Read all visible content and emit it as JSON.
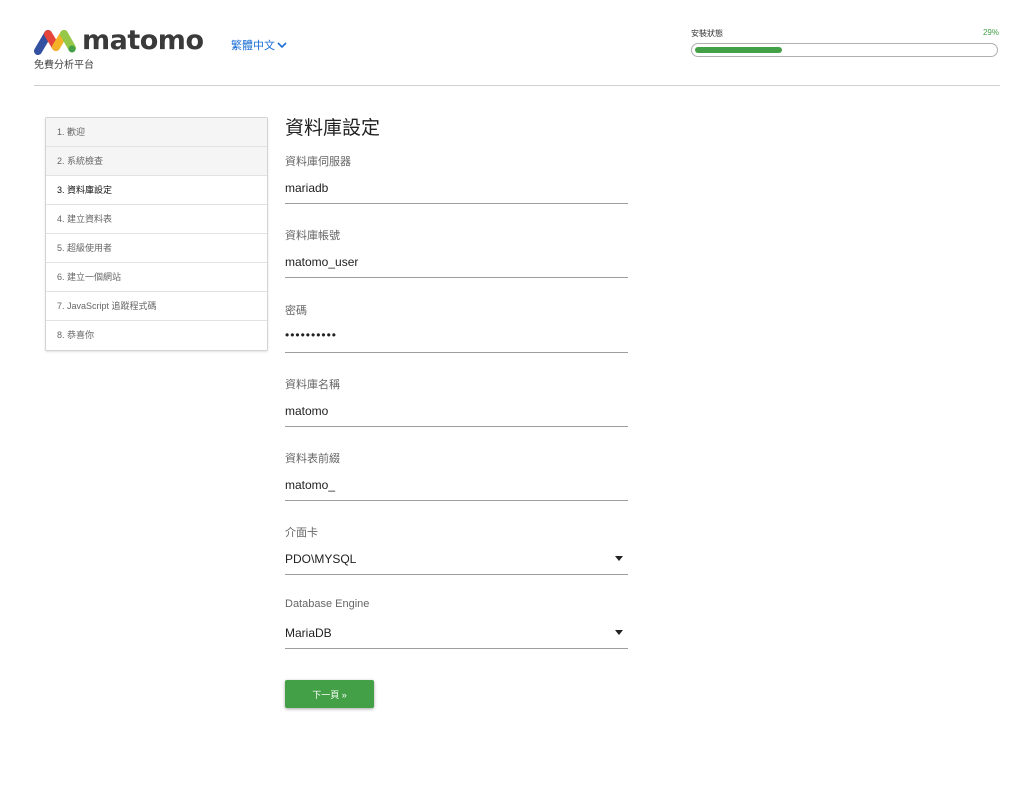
{
  "app": {
    "name": "matomo",
    "tagline": "免費分析平台",
    "language": "繁體中文"
  },
  "progress": {
    "label": "安裝狀態",
    "percent_text": "29%",
    "percent": 29,
    "color": "#43a047"
  },
  "steps": [
    {
      "label": "1. 歡迎",
      "state": "done"
    },
    {
      "label": "2. 系統檢查",
      "state": "done"
    },
    {
      "label": "3. 資料庫設定",
      "state": "current"
    },
    {
      "label": "4. 建立資料表",
      "state": "pending"
    },
    {
      "label": "5. 超級使用者",
      "state": "pending"
    },
    {
      "label": "6. 建立一個網站",
      "state": "pending"
    },
    {
      "label": "7. JavaScript 追蹤程式碼",
      "state": "pending"
    },
    {
      "label": "8. 恭喜你",
      "state": "pending"
    }
  ],
  "form": {
    "title": "資料庫設定",
    "db_server": {
      "label": "資料庫伺服器",
      "value": "mariadb"
    },
    "db_user": {
      "label": "資料庫帳號",
      "value": "matomo_user"
    },
    "password": {
      "label": "密碼",
      "value": "••••••••••"
    },
    "db_name": {
      "label": "資料庫名稱",
      "value": "matomo"
    },
    "table_prefix": {
      "label": "資料表前綴",
      "value": "matomo_"
    },
    "adapter": {
      "label": "介面卡",
      "value": "PDO\\MYSQL"
    },
    "engine": {
      "label": "Database Engine",
      "value": "MariaDB"
    },
    "next_label": "下一頁 »"
  },
  "icons": {
    "logo": "matomo-logo-icon",
    "language_caret": "chevron-down-icon",
    "select_caret": "caret-down-icon"
  }
}
